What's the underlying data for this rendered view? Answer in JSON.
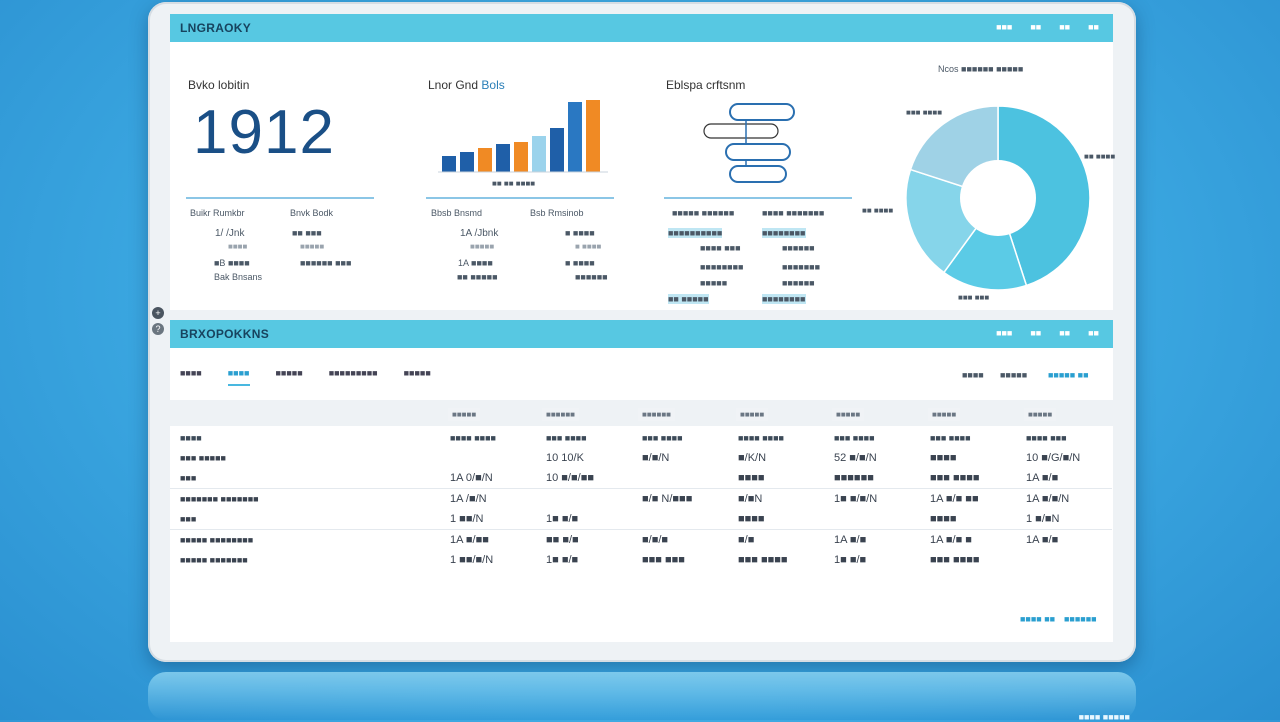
{
  "device": {
    "side_icons": [
      "+",
      "?"
    ]
  },
  "dashboard": {
    "title": "LNGRAOKY",
    "nav": [
      "■■■",
      "■■",
      "■■",
      "■■"
    ],
    "kpi": {
      "label": "Bvko lobitin",
      "value": "1912",
      "col1_head": "Buikr Rumkbr",
      "col2_head": "Bnvk Bodk",
      "rows": [
        [
          "1/ /Jnk",
          "■■ ■■■"
        ],
        [
          "■■■■",
          "■■■■■"
        ],
        [
          "■B ■■■■",
          "■■■■■■ ■■■"
        ],
        [
          "Bak Bnsans",
          ""
        ]
      ]
    },
    "bar_chart": {
      "title": "Lnor Gnd",
      "title_accent": "Bols",
      "caption": "■■ ■■ ■■■■",
      "col1_head": "Bbsb Bnsmd",
      "col2_head": "Bsb Rmsinob",
      "rows": [
        [
          "1A /Jbnk",
          "■ ■■■■"
        ],
        [
          "■■■■■",
          "■ ■■■■"
        ],
        [
          "1A ■■■■",
          "■ ■■■■"
        ],
        [
          "■■ ■■■■■",
          "■■■■■■"
        ]
      ]
    },
    "diagram": {
      "title": "Eblspa crftsnm",
      "col1_head": "■■■■■ ■■■■■■",
      "col2_head": "■■■■ ■■■■■■■",
      "rows": [
        [
          "■■■■■■■■■■",
          "■■■■■■■■"
        ],
        [
          "■■■■ ■■■",
          "■■■■■■"
        ],
        [
          "■■■■■■■■",
          "■■■■■■■"
        ],
        [
          "■■■■■",
          "■■■■■■"
        ],
        [
          "■■ ■■■■■",
          "■■■■■■■■"
        ]
      ]
    },
    "donut": {
      "title": "Ncos ■■■■■■ ■■■■■",
      "labels": [
        "■■■ ■■■■",
        "■■ ■■■■",
        "■■ ■■■■",
        "■■■ ■■■"
      ],
      "slices": [
        {
          "value": 45,
          "color": "#4cc2e0"
        },
        {
          "value": 15,
          "color": "#5bcbe6"
        },
        {
          "value": 20,
          "color": "#86d5ea"
        },
        {
          "value": 20,
          "color": "#9fd2e6"
        }
      ]
    }
  },
  "reports": {
    "title": "BRXOPOKKNS",
    "nav": [
      "■■■",
      "■■",
      "■■",
      "■■"
    ],
    "tabs": [
      {
        "label": "■■■■",
        "active": false
      },
      {
        "label": "■■■■",
        "active": true
      },
      {
        "label": "■■■■■",
        "active": false
      },
      {
        "label": "■■■■■■■■■",
        "active": false
      },
      {
        "label": "■■■■■",
        "active": false
      }
    ],
    "right_tabs": [
      "■■■■",
      "■■■■■",
      "■■■■■ ■■"
    ],
    "column_groups": [
      "■■■■■",
      "■■■■■■",
      "■■■■■■",
      "■■■■■",
      "■■■■■",
      "■■■■■",
      "■■■■■"
    ],
    "headers": [
      "■■■■",
      "■■■■ ■■■■",
      "■■■ ■■■■",
      "■■■ ■■■■",
      "■■■■ ■■■■",
      "■■■ ■■■■",
      "■■■ ■■■■",
      "■■■■ ■■■"
    ],
    "rows": [
      [
        "■■■ ■■■■■",
        "",
        "10 10/K",
        "■/■/N",
        "■/K/N",
        "52 ■/■/N",
        "■■■■",
        "10 ■/G/■/N"
      ],
      [
        "■■■",
        "1A 0/■/N",
        "10 ■/■/■■",
        "",
        "■■■■",
        "■■■■■■",
        "■■■ ■■■■",
        "1A ■/■"
      ],
      [
        "■■■■■■■ ■■■■■■■",
        "1A /■/N",
        "",
        "■/■ N/■■■",
        "■/■N",
        "1■ ■/■/N",
        "1A ■/■ ■■",
        "1A ■/■/N"
      ],
      [
        "■■■",
        "1 ■■/N",
        "1■ ■/■",
        "",
        "■■■■",
        "",
        "■■■■",
        "1 ■/■N"
      ],
      [
        "■■■■■ ■■■■■■■■",
        "1A ■/■■",
        "■■ ■/■",
        "■/■/■",
        "■/■",
        "1A ■/■",
        "1A ■/■ ■",
        "1A ■/■"
      ],
      [
        "■■■■■ ■■■■■■■",
        "1 ■■/■/N",
        "1■ ■/■",
        "■■■ ■■■",
        "■■■ ■■■■",
        "1■ ■/■",
        "■■■ ■■■■",
        ""
      ]
    ],
    "footer_links": [
      "■■■■ ■■",
      "■■■■■■"
    ]
  },
  "reflection_text": "■■■■ ■■■■■"
}
